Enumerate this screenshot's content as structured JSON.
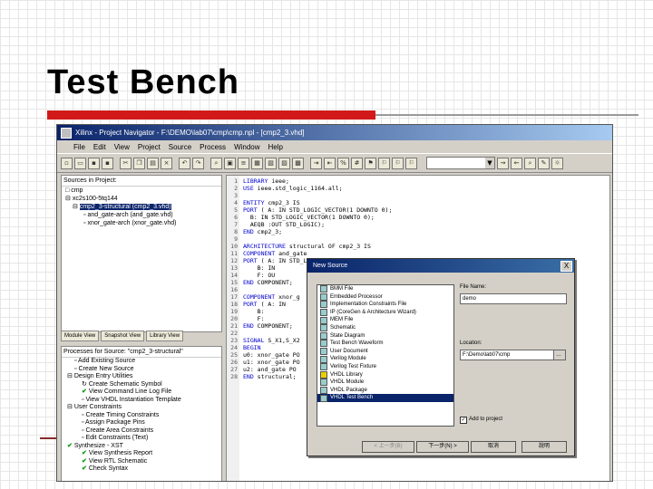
{
  "slide": {
    "title": "Test Bench"
  },
  "window": {
    "title": "Xilinx - Project Navigator - F:\\DEMO\\lab07\\cmp\\cmp.npl - [cmp2_3.vhd]",
    "menu": [
      "File",
      "Edit",
      "View",
      "Project",
      "Source",
      "Process",
      "Window",
      "Help"
    ]
  },
  "sources": {
    "header": "Sources in Project:",
    "items": [
      {
        "label": "cmp"
      },
      {
        "label": "xc2s100-5tq144"
      },
      {
        "label": "cmp2_3-structural (cmp2_3.vhd)"
      },
      {
        "label": "and_gate-arch (and_gate.vhd)"
      },
      {
        "label": "xnor_gate-arch (xnor_gate.vhd)"
      }
    ],
    "tabs": [
      "Module View",
      "Snapshot View",
      "Library View"
    ]
  },
  "processes": {
    "header": "Processes for Source: \"cmp2_3-structural\"",
    "items": [
      {
        "label": "Add Existing Source"
      },
      {
        "label": "Create New Source"
      },
      {
        "label": "Design Entry Utilities"
      },
      {
        "label": "Create Schematic Symbol"
      },
      {
        "label": "View Command Line Log File"
      },
      {
        "label": "View VHDL Instantiation Template"
      },
      {
        "label": "User Constraints"
      },
      {
        "label": "Create Timing Constraints"
      },
      {
        "label": "Assign Package Pins"
      },
      {
        "label": "Create Area Constraints"
      },
      {
        "label": "Edit Constraints (Text)"
      },
      {
        "label": "Synthesize - XST"
      },
      {
        "label": "View Synthesis Report"
      },
      {
        "label": "View RTL Schematic"
      },
      {
        "label": "Check Syntax"
      }
    ]
  },
  "editor": {
    "lines": [
      {
        "n": "1",
        "kw": "LIBRARY",
        "rest": " ieee;"
      },
      {
        "n": "2",
        "kw": "USE",
        "rest": " ieee.std_logic_1164.all;"
      },
      {
        "n": "3",
        "kw": "",
        "rest": ""
      },
      {
        "n": "4",
        "kw": "ENTITY",
        "rest": " cmp2_3 IS"
      },
      {
        "n": "5",
        "kw": "PORT",
        "rest": " ( A: IN STD_LOGIC_VECTOR(1 DOWNTO 0);"
      },
      {
        "n": "6",
        "kw": "",
        "rest": "  B: IN STD_LOGIC_VECTOR(1 DOWNTO 0);"
      },
      {
        "n": "7",
        "kw": "",
        "rest": "  AEQB :OUT STD_LOGIC);"
      },
      {
        "n": "8",
        "kw": "END",
        "rest": " cmp2_3;"
      },
      {
        "n": "9",
        "kw": "",
        "rest": ""
      },
      {
        "n": "10",
        "kw": "ARCHITECTURE",
        "rest": " structural OF cmp2_3 IS"
      },
      {
        "n": "11",
        "kw": "COMPONENT",
        "rest": " and_gate"
      },
      {
        "n": "12",
        "kw": "PORT",
        "rest": " ( A: IN STD_LOGIC;"
      },
      {
        "n": "13",
        "kw": "",
        "rest": "    B: IN"
      },
      {
        "n": "14",
        "kw": "",
        "rest": "    F: OU"
      },
      {
        "n": "15",
        "kw": "END",
        "rest": " COMPONENT;"
      },
      {
        "n": "16",
        "kw": "",
        "rest": ""
      },
      {
        "n": "17",
        "kw": "COMPONENT",
        "rest": " xnor_g"
      },
      {
        "n": "18",
        "kw": "PORT",
        "rest": " ( A: IN"
      },
      {
        "n": "19",
        "kw": "",
        "rest": "    B:"
      },
      {
        "n": "20",
        "kw": "",
        "rest": "    F:"
      },
      {
        "n": "21",
        "kw": "END",
        "rest": " COMPONENT;"
      },
      {
        "n": "22",
        "kw": "",
        "rest": ""
      },
      {
        "n": "23",
        "kw": "SIGNAL",
        "rest": " S_X1,S_X2"
      },
      {
        "n": "24",
        "kw": "BEGIN",
        "rest": ""
      },
      {
        "n": "25",
        "kw": "",
        "rest": "u0: xnor_gate PO"
      },
      {
        "n": "26",
        "kw": "",
        "rest": "u1: xnor_gate PO"
      },
      {
        "n": "27",
        "kw": "",
        "rest": "u2: and_gate PO"
      },
      {
        "n": "28",
        "kw": "END",
        "rest": " structural;"
      }
    ]
  },
  "dialog": {
    "title": "New Source",
    "close": "X",
    "items": [
      {
        "label": "BMM File"
      },
      {
        "label": "Embedded Processor"
      },
      {
        "label": "Implementation Constraints File"
      },
      {
        "label": "IP (CoreGen & Architecture Wizard)"
      },
      {
        "label": "MEM File"
      },
      {
        "label": "Schematic"
      },
      {
        "label": "State Diagram"
      },
      {
        "label": "Test Bench Waveform"
      },
      {
        "label": "User Document"
      },
      {
        "label": "Verilog Module"
      },
      {
        "label": "Verilog Test Fixture"
      },
      {
        "label": "VHDL Library"
      },
      {
        "label": "VHDL Module"
      },
      {
        "label": "VHDL Package"
      },
      {
        "label": "VHDL Test Bench"
      }
    ],
    "file_name_label": "File Name:",
    "file_name_value": "demo",
    "location_label": "Location:",
    "location_value": "F:\\Demo\\lab07\\cmp",
    "add_to_project": "Add to project",
    "back_button": "< 上一步(B)",
    "next_button": "下一步(N) >",
    "cancel_button": "取消",
    "help_button": "說明"
  }
}
